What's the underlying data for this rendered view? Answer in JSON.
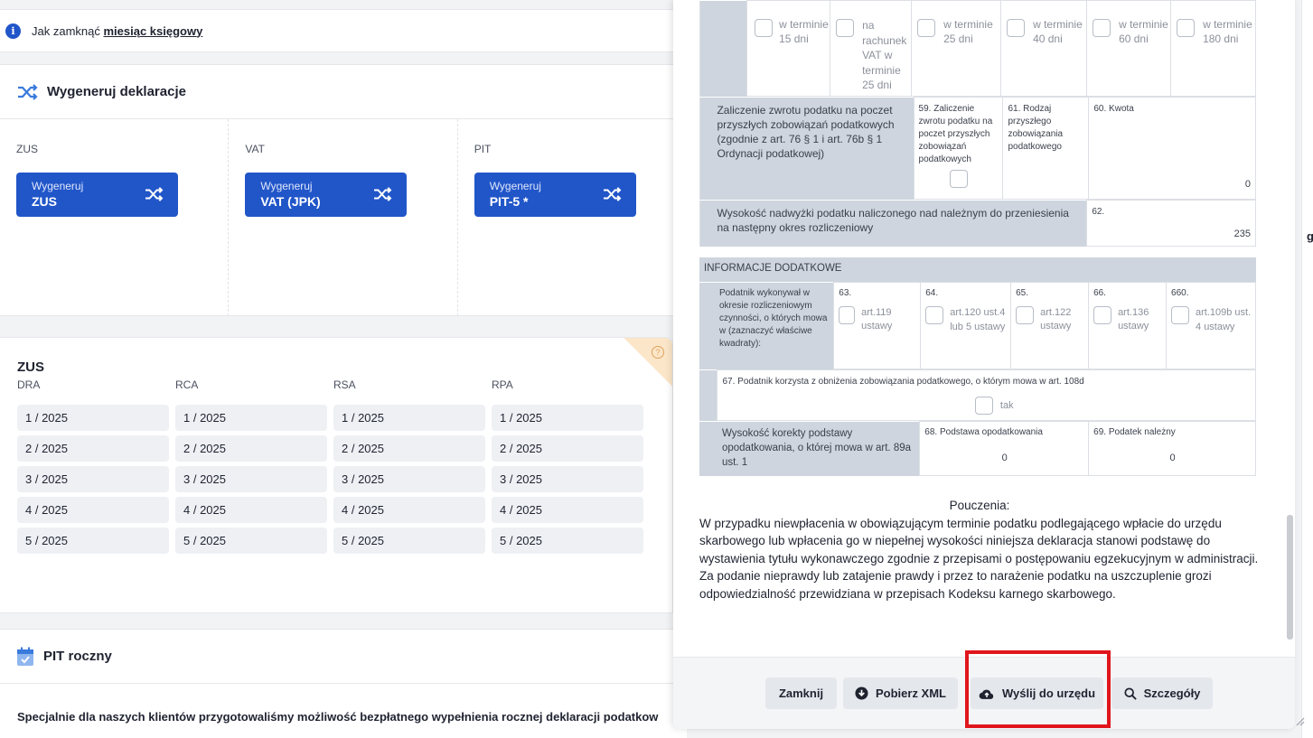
{
  "info": {
    "prefix": "Jak zamknąć ",
    "link": "miesiąc księgowy"
  },
  "generate": {
    "title": "Wygeneruj deklaracje",
    "columns": [
      {
        "label": "ZUS",
        "btn_line1": "Wygeneruj",
        "btn_line2": "ZUS"
      },
      {
        "label": "VAT",
        "btn_line1": "Wygeneruj",
        "btn_line2": "VAT (JPK)"
      },
      {
        "label": "PIT",
        "btn_line1": "Wygeneruj",
        "btn_line2": "PIT-5 *"
      }
    ]
  },
  "zus": {
    "title": "ZUS",
    "corner_icon": "?",
    "headers": [
      "DRA",
      "RCA",
      "RSA",
      "RPA"
    ],
    "rows": [
      [
        "1 / 2025",
        "1 / 2025",
        "1 / 2025",
        "1 / 2025"
      ],
      [
        "2 / 2025",
        "2 / 2025",
        "2 / 2025",
        "2 / 2025"
      ],
      [
        "3 / 2025",
        "3 / 2025",
        "3 / 2025",
        "3 / 2025"
      ],
      [
        "4 / 2025",
        "4 / 2025",
        "4 / 2025",
        "4 / 2025"
      ],
      [
        "5 / 2025",
        "5 / 2025",
        "5 / 2025",
        "5 / 2025"
      ]
    ]
  },
  "pit": {
    "title": "PIT roczny",
    "text": "Specjalnie dla naszych klientów przygotowaliśmy możliwość bezpłatnego wypełnienia rocznej deklaracji podatkow"
  },
  "right_strip": {
    "char": "g"
  },
  "modal": {
    "terms": [
      {
        "l1": "w terminie",
        "l2": "15 dni"
      },
      {
        "l1": "na",
        "l2": "rachunek",
        "l3": "VAT w",
        "l4": "terminie",
        "l5": "25 dni"
      },
      {
        "l1": "w terminie",
        "l2": "25 dni"
      },
      {
        "l1": "w terminie",
        "l2": "40 dni"
      },
      {
        "l1": "w terminie",
        "l2": "60 dni"
      },
      {
        "l1": "w terminie",
        "l2": "180 dni"
      }
    ],
    "zaliczenie": {
      "label": "Zaliczenie zwrotu podatku na poczet przyszłych zobowiązań podatkowych (zgodnie z art. 76 § 1 i art. 76b § 1 Ordynacji podatkowej)",
      "f59": "59. Zaliczenie zwrotu podatku na poczet przyszłych zobowiązań podatkowych",
      "f61": "61. Rodzaj przyszłego zobowiązania podatkowego",
      "f60": "60. Kwota",
      "f60_value": "0"
    },
    "nadwyzka": {
      "label": "Wysokość nadwyżki podatku naliczonego nad należnym do przeniesienia na następny okres rozliczeniowy",
      "field": "62.",
      "value": "235"
    },
    "info_title": "INFORMACJE DODATKOWE",
    "podatnik": {
      "label": "Podatnik wykonywał w okresie rozliczeniowym czynności, o których mowa w (zaznaczyć właściwe kwadraty):",
      "options": [
        {
          "num": "63.",
          "text": "art.119 ustawy"
        },
        {
          "num": "64.",
          "text": "art.120 ust.4 lub 5 ustawy"
        },
        {
          "num": "65.",
          "text": "art.122 ustawy"
        },
        {
          "num": "66.",
          "text": "art.136 ustawy"
        },
        {
          "num": "660.",
          "text": "art.109b ust. 4 ustawy"
        }
      ]
    },
    "f67": {
      "label": "67. Podatnik korzysta z obniżenia zobowiązania podatkowego, o którym mowa w art. 108d",
      "option": "tak"
    },
    "korekta": {
      "label": "Wysokość korekty podstawy opodatkowania, o której mowa w art. 89a ust. 1",
      "f68": "68. Podstawa opodatkowania",
      "f68_value": "0",
      "f69": "69. Podatek należny",
      "f69_value": "0"
    },
    "pouczenia": {
      "title": "Pouczenia:",
      "p1": "W przypadku niewpłacenia w obowiązującym terminie podatku podlegającego wpłacie do urzędu skarbowego lub wpłacenia go w niepełnej wysokości niniejsza deklaracja stanowi podstawę do wystawienia tytułu wykonawczego zgodnie z przepisami o postępowaniu egzekucyjnym w administracji.",
      "p2": "Za podanie nieprawdy lub zatajenie prawdy i przez to narażenie podatku na uszczuplenie grozi odpowiedzialność przewidziana w przepisach Kodeksu karnego skarbowego."
    },
    "footer": {
      "close": "Zamknij",
      "download": "Pobierz XML",
      "send": "Wyślij do urzędu",
      "details": "Szczegóły"
    }
  },
  "colors": {
    "primary": "#2156c9",
    "highlight": "#e0161c",
    "form_gray": "#ced5de"
  }
}
